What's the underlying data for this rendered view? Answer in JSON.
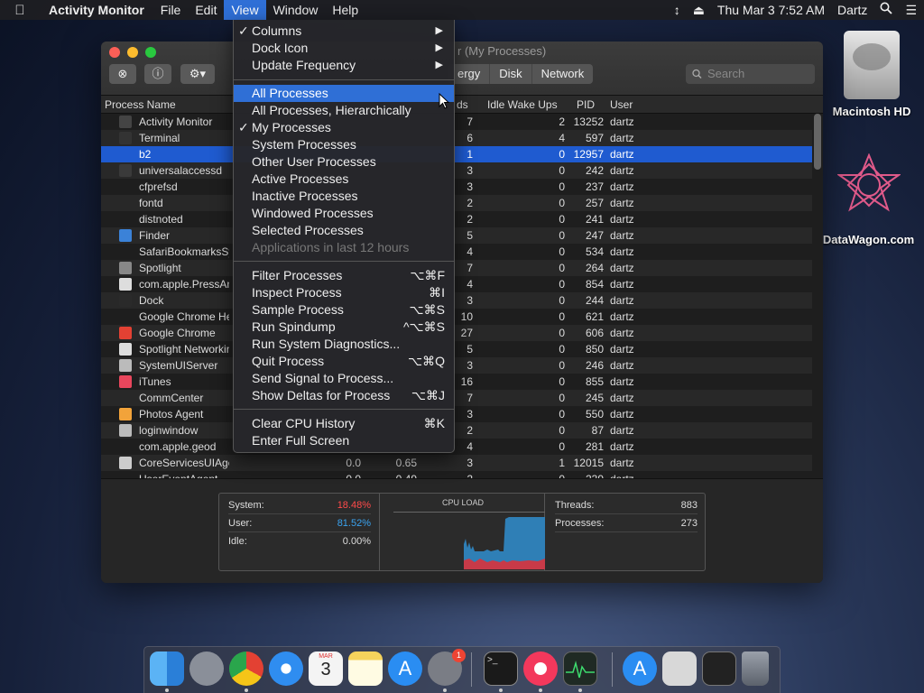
{
  "menubar": {
    "app_name": "Activity Monitor",
    "menus": [
      "File",
      "Edit",
      "View",
      "Window",
      "Help"
    ],
    "datetime": "Thu Mar 3  7:52 AM",
    "user": "Dartz"
  },
  "desktop": {
    "hd_label": "Macintosh HD",
    "dw_label": "DataWagon.com"
  },
  "window": {
    "title": "r (My Processes)",
    "tabs": [
      "ergy",
      "Disk",
      "Network"
    ],
    "search_placeholder": "Search",
    "columns": {
      "process_name": "Process Name",
      "threads": "ds",
      "idle_wake": "Idle Wake Ups",
      "pid": "PID",
      "user": "User"
    },
    "rows": [
      {
        "name": "Activity Monitor",
        "cpu": "",
        "time": "",
        "threads": "7",
        "idle": "2",
        "pid": "13252",
        "user": "dartz"
      },
      {
        "name": "Terminal",
        "cpu": "",
        "time": "",
        "threads": "6",
        "idle": "4",
        "pid": "597",
        "user": "dartz"
      },
      {
        "name": "b2",
        "cpu": "",
        "time": "",
        "threads": "1",
        "idle": "0",
        "pid": "12957",
        "user": "dartz"
      },
      {
        "name": "universalaccessd",
        "cpu": "",
        "time": "",
        "threads": "3",
        "idle": "0",
        "pid": "242",
        "user": "dartz"
      },
      {
        "name": "cfprefsd",
        "cpu": "",
        "time": "",
        "threads": "3",
        "idle": "0",
        "pid": "237",
        "user": "dartz"
      },
      {
        "name": "fontd",
        "cpu": "",
        "time": "",
        "threads": "2",
        "idle": "0",
        "pid": "257",
        "user": "dartz"
      },
      {
        "name": "distnoted",
        "cpu": "",
        "time": "",
        "threads": "2",
        "idle": "0",
        "pid": "241",
        "user": "dartz"
      },
      {
        "name": "Finder",
        "cpu": "",
        "time": "",
        "threads": "5",
        "idle": "0",
        "pid": "247",
        "user": "dartz"
      },
      {
        "name": "SafariBookmarksSyn",
        "cpu": "",
        "time": "",
        "threads": "4",
        "idle": "0",
        "pid": "534",
        "user": "dartz"
      },
      {
        "name": "Spotlight",
        "cpu": "",
        "time": "",
        "threads": "7",
        "idle": "0",
        "pid": "264",
        "user": "dartz"
      },
      {
        "name": "com.apple.PressAnd",
        "cpu": "",
        "time": "",
        "threads": "4",
        "idle": "0",
        "pid": "854",
        "user": "dartz"
      },
      {
        "name": "Dock",
        "cpu": "",
        "time": "",
        "threads": "3",
        "idle": "0",
        "pid": "244",
        "user": "dartz"
      },
      {
        "name": "Google Chrome Hel",
        "cpu": "",
        "time": "",
        "threads": "10",
        "idle": "0",
        "pid": "621",
        "user": "dartz"
      },
      {
        "name": "Google Chrome",
        "cpu": "",
        "time": "",
        "threads": "27",
        "idle": "0",
        "pid": "606",
        "user": "dartz"
      },
      {
        "name": "Spotlight Networkin",
        "cpu": "",
        "time": "",
        "threads": "5",
        "idle": "0",
        "pid": "850",
        "user": "dartz"
      },
      {
        "name": "SystemUIServer",
        "cpu": "",
        "time": "",
        "threads": "3",
        "idle": "0",
        "pid": "246",
        "user": "dartz"
      },
      {
        "name": "iTunes",
        "cpu": "",
        "time": "",
        "threads": "16",
        "idle": "0",
        "pid": "855",
        "user": "dartz"
      },
      {
        "name": "CommCenter",
        "cpu": "",
        "time": "",
        "threads": "7",
        "idle": "0",
        "pid": "245",
        "user": "dartz"
      },
      {
        "name": "Photos Agent",
        "cpu": "",
        "time": "",
        "threads": "3",
        "idle": "0",
        "pid": "550",
        "user": "dartz"
      },
      {
        "name": "loginwindow",
        "cpu": "",
        "time": "",
        "threads": "2",
        "idle": "0",
        "pid": "87",
        "user": "dartz"
      },
      {
        "name": "com.apple.geod",
        "cpu": "",
        "time": "",
        "threads": "4",
        "idle": "0",
        "pid": "281",
        "user": "dartz"
      },
      {
        "name": "CoreServicesUIAgent",
        "cpu": "0.0",
        "time": "0.65",
        "threads": "3",
        "idle": "1",
        "pid": "12015",
        "user": "dartz"
      },
      {
        "name": "UserEventAgent",
        "cpu": "0.0",
        "time": "0.49",
        "threads": "2",
        "idle": "0",
        "pid": "239",
        "user": "dartz"
      }
    ],
    "stats": {
      "system_label": "System:",
      "system_value": "18.48%",
      "user_label": "User:",
      "user_value": "81.52%",
      "idle_label": "Idle:",
      "idle_value": "0.00%",
      "cpu_load_title": "CPU LOAD",
      "threads_label": "Threads:",
      "threads_value": "883",
      "processes_label": "Processes:",
      "processes_value": "273"
    }
  },
  "view_menu": {
    "columns": "Columns",
    "dock_icon": "Dock Icon",
    "update_frequency": "Update Frequency",
    "all_processes": "All Processes",
    "all_hier": "All Processes, Hierarchically",
    "my_processes": "My Processes",
    "system_processes": "System Processes",
    "other_user": "Other User Processes",
    "active": "Active Processes",
    "inactive": "Inactive Processes",
    "windowed": "Windowed Processes",
    "selected": "Selected Processes",
    "apps_12h": "Applications in last 12 hours",
    "filter": "Filter Processes",
    "filter_sc": "⌥⌘F",
    "inspect": "Inspect Process",
    "inspect_sc": "⌘I",
    "sample": "Sample Process",
    "sample_sc": "⌥⌘S",
    "spindump": "Run Spindump",
    "spindump_sc": "^⌥⌘S",
    "diagnostics": "Run System Diagnostics...",
    "quit": "Quit Process",
    "quit_sc": "⌥⌘Q",
    "signal": "Send Signal to Process...",
    "deltas": "Show Deltas for Process",
    "deltas_sc": "⌥⌘J",
    "clear_cpu": "Clear CPU History",
    "clear_cpu_sc": "⌘K",
    "fullscreen": "Enter Full Screen"
  },
  "colors": {
    "accent": "#2f6fd6",
    "system_red": "#ff4a4a",
    "user_blue": "#3aa3f0"
  },
  "dock": {
    "calendar_month": "MAR",
    "calendar_day": "3",
    "badge_count": "1"
  }
}
